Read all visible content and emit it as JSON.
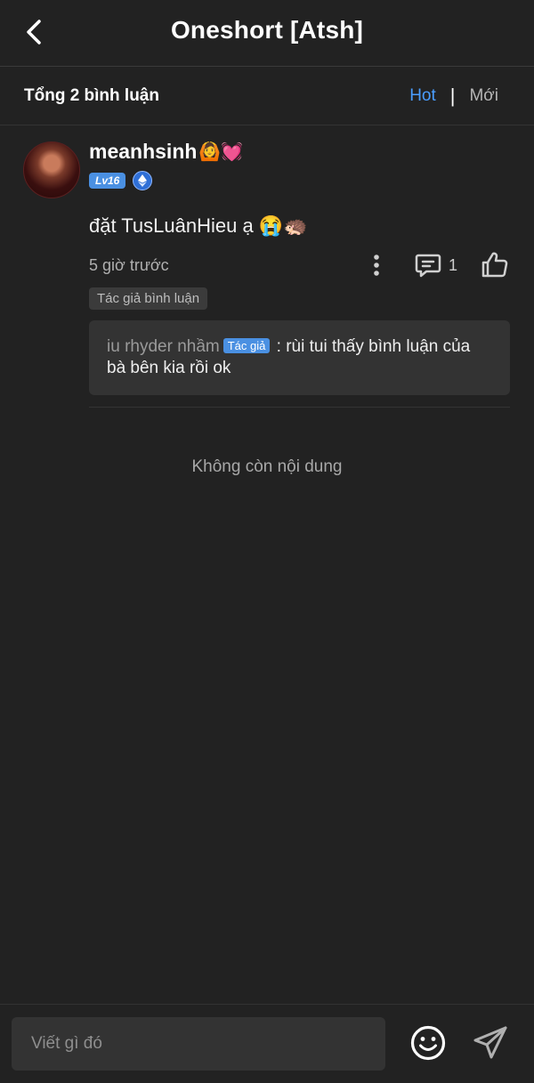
{
  "header": {
    "title": "Oneshort [Atsh]"
  },
  "summary": {
    "total": "Tổng 2 bình luận",
    "sort_hot": "Hot",
    "sort_separator": "|",
    "sort_new": "Mới"
  },
  "comment": {
    "username": "meanhsinh",
    "username_emojis": "🙆💓",
    "level": "Lv16",
    "text": "đặt TusLuânHieu ạ 😭🦔",
    "time": "5 giờ trước",
    "reply_count": "1",
    "author_tag": "Tác giả bình luận"
  },
  "reply": {
    "author": "iu rhyder nhầm",
    "tag": "Tác giả",
    "text": " : rùi tui thấy bình luận của bà bên kia rồi ok"
  },
  "empty_note": "Không còn nội dung",
  "composer": {
    "placeholder": "Viết gì đó"
  },
  "colors": {
    "background": "#222222",
    "accent": "#4a9eff",
    "level_badge": "#4a90e2"
  }
}
